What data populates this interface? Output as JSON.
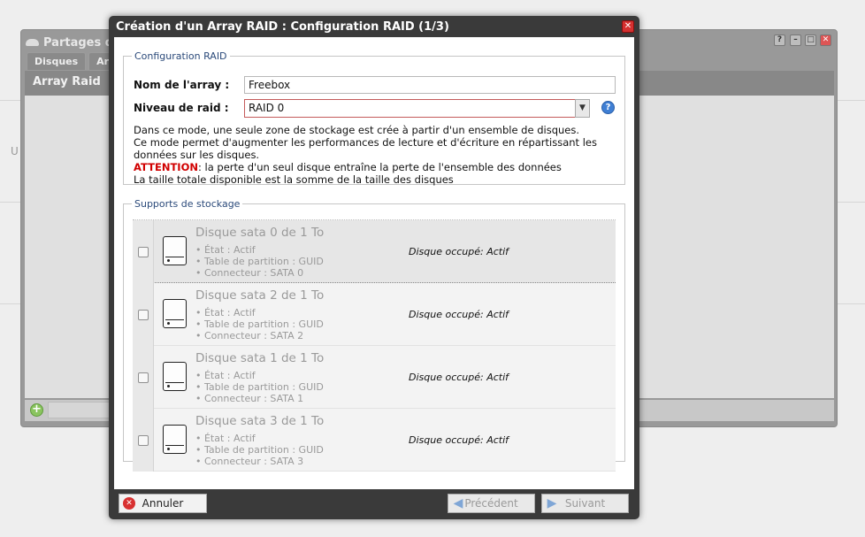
{
  "background": {
    "desktop_letter": "U",
    "window_title": "Partages de",
    "tabs": [
      "Disques",
      "Arr"
    ],
    "subheader": "Array Raid",
    "controls": {
      "help": "?",
      "minimize": "–",
      "maximize": "□",
      "close": "✕"
    }
  },
  "dialog": {
    "title": "Création d'un Array RAID : Configuration RAID (1/3)",
    "close": "✕",
    "config": {
      "legend": "Configuration RAID",
      "name_label": "Nom de l'array :",
      "name_value": "Freebox",
      "level_label": "Niveau de raid :",
      "level_value": "RAID 0",
      "help": "?",
      "desc_lines": [
        "Dans ce mode, une seule zone de stockage est crée à partir d'un ensemble de disques.",
        "Ce mode permet d'augmenter les performances de lecture et d'écriture en répartissant les données sur les disques."
      ],
      "warning_label": "ATTENTION",
      "warning_text": ": la perte d'un seul disque entraîne la perte de l'ensemble des données",
      "total_text": "La taille totale disponible est la somme de la taille des disques"
    },
    "storage": {
      "legend": "Supports de stockage",
      "disks": [
        {
          "name": "Disque sata 0 de 1 To",
          "state": "• État : Actif",
          "table": "• Table de partition : GUID",
          "connector": "• Connecteur : SATA 0",
          "status": "Disque occupé: Actif"
        },
        {
          "name": "Disque sata 2 de 1 To",
          "state": "• État : Actif",
          "table": "• Table de partition : GUID",
          "connector": "• Connecteur : SATA 2",
          "status": "Disque occupé: Actif"
        },
        {
          "name": "Disque sata 1 de 1 To",
          "state": "• État : Actif",
          "table": "• Table de partition : GUID",
          "connector": "• Connecteur : SATA 1",
          "status": "Disque occupé: Actif"
        },
        {
          "name": "Disque sata 3 de 1 To",
          "state": "• État : Actif",
          "table": "• Table de partition : GUID",
          "connector": "• Connecteur : SATA 3",
          "status": "Disque occupé: Actif"
        }
      ]
    },
    "buttons": {
      "cancel": "Annuler",
      "previous": "Précédent",
      "next": "Suivant"
    }
  }
}
